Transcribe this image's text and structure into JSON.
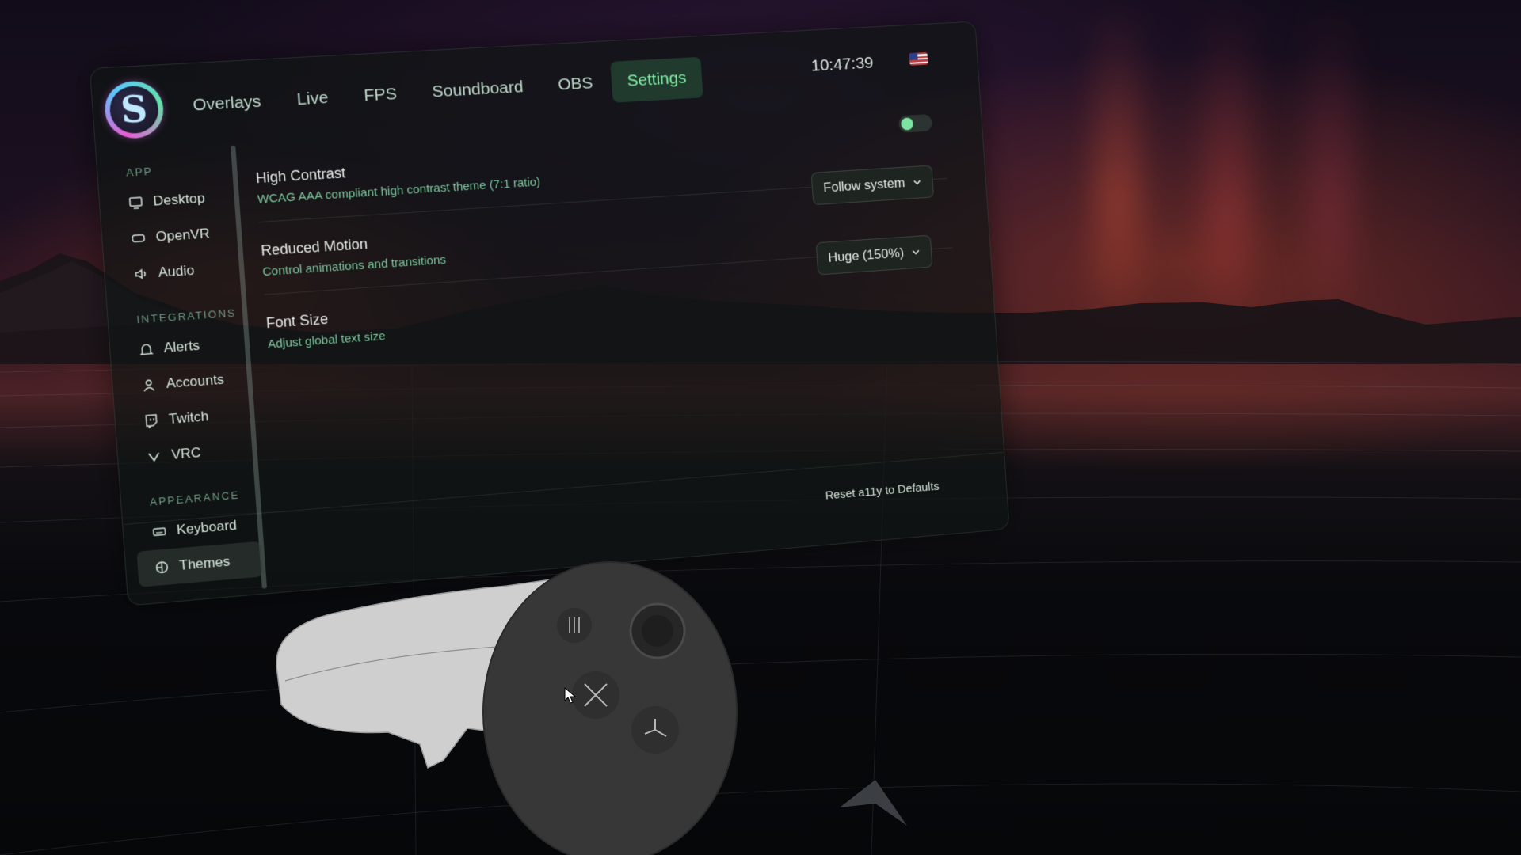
{
  "header": {
    "tabs": [
      {
        "label": "Overlays"
      },
      {
        "label": "Live"
      },
      {
        "label": "FPS"
      },
      {
        "label": "Soundboard"
      },
      {
        "label": "OBS"
      },
      {
        "label": "Settings",
        "active": true
      }
    ],
    "clock": "10:47:39",
    "locale_icon": "us-flag-icon"
  },
  "sidebar": {
    "sections": [
      {
        "label": "APP",
        "items": [
          {
            "label": "Desktop",
            "icon": "monitor-icon"
          },
          {
            "label": "OpenVR",
            "icon": "vr-headset-icon"
          },
          {
            "label": "Audio",
            "icon": "speaker-icon"
          }
        ]
      },
      {
        "label": "INTEGRATIONS",
        "items": [
          {
            "label": "Alerts",
            "icon": "bell-icon"
          },
          {
            "label": "Accounts",
            "icon": "user-icon"
          },
          {
            "label": "Twitch",
            "icon": "twitch-icon"
          },
          {
            "label": "VRC",
            "icon": "vrc-icon"
          }
        ]
      },
      {
        "label": "APPEARANCE",
        "items": [
          {
            "label": "Keyboard",
            "icon": "keyboard-icon"
          },
          {
            "label": "Themes",
            "icon": "palette-icon",
            "active": true
          }
        ]
      }
    ]
  },
  "settings": {
    "high_contrast": {
      "title": "High Contrast",
      "description": "WCAG AAA compliant high contrast theme (7:1 ratio)",
      "enabled": false
    },
    "reduced_motion": {
      "title": "Reduced Motion",
      "description": "Control animations and transitions",
      "value": "Follow system"
    },
    "font_size": {
      "title": "Font Size",
      "description": "Adjust global text size",
      "value": "Huge (150%)"
    },
    "reset_label": "Reset a11y to Defaults"
  },
  "colors": {
    "accent": "#7ff0a6",
    "description_text": "#79c79c",
    "panel_bg": "#0e1412"
  }
}
